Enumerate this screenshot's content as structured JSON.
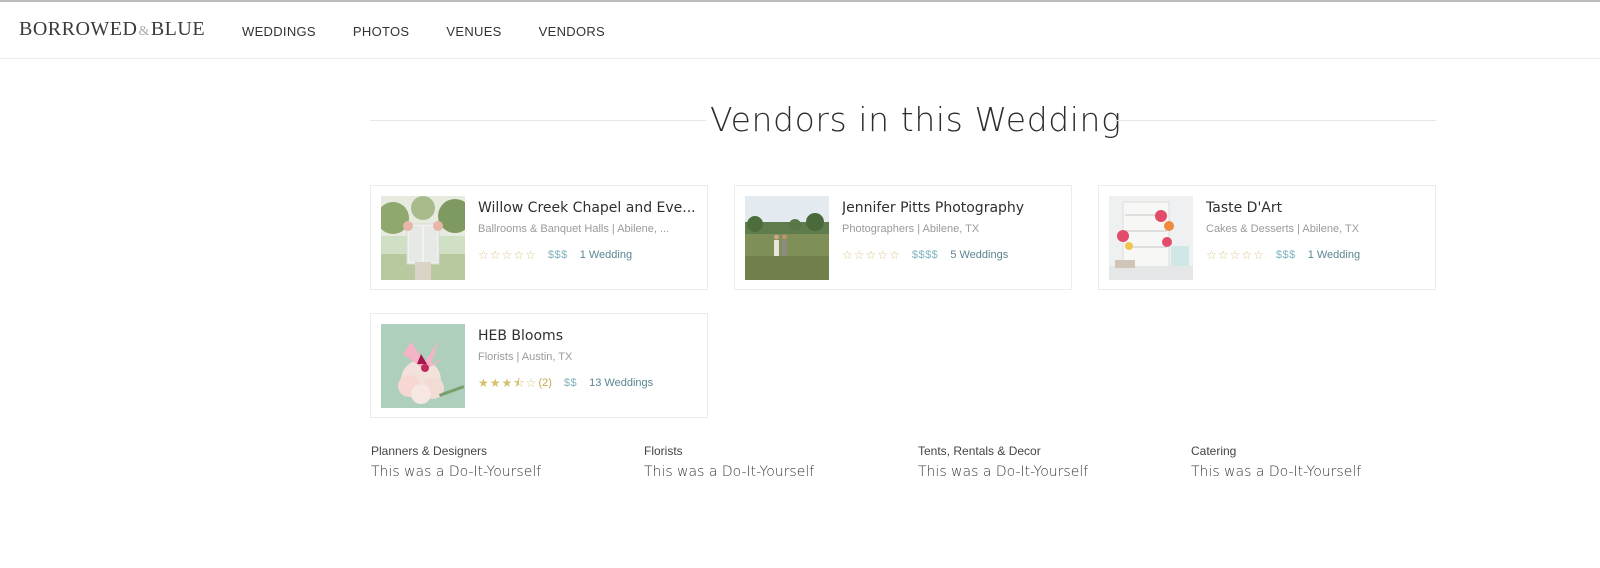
{
  "brand": {
    "logo_left": "BORROWED",
    "logo_amp": "&",
    "logo_right": "BLUE"
  },
  "nav": {
    "items": [
      {
        "label": "WEDDINGS"
      },
      {
        "label": "PHOTOS"
      },
      {
        "label": "VENUES"
      },
      {
        "label": "VENDORS"
      }
    ]
  },
  "section": {
    "title": "Vendors in this Wedding"
  },
  "colors": {
    "star": "#d6bf6a",
    "price": "#7fb3bd",
    "weddings_link": "#5b8593",
    "divider": "#e6e6e6"
  },
  "vendors": [
    {
      "name": "Willow Creek Chapel and Eve...",
      "meta": "Ballrooms & Banquet Halls | Abilene, ...",
      "rating": 0,
      "rating_count": "",
      "price": "$$$",
      "weddings": "1 Wedding",
      "image_icon": "chapel-photo"
    },
    {
      "name": "Jennifer Pitts Photography",
      "meta": "Photographers | Abilene, TX",
      "rating": 0,
      "rating_count": "",
      "price": "$$$$",
      "weddings": "5 Weddings",
      "image_icon": "couple-field-photo"
    },
    {
      "name": "Taste D'Art",
      "meta": "Cakes & Desserts | Abilene, TX",
      "rating": 0,
      "rating_count": "",
      "price": "$$$",
      "weddings": "1 Wedding",
      "image_icon": "dessert-table-photo"
    },
    {
      "name": "HEB Blooms",
      "meta": "Florists | Austin, TX",
      "rating": 3.5,
      "rating_count": "(2)",
      "price": "$$",
      "weddings": "13 Weddings",
      "image_icon": "bouquet-photo"
    }
  ],
  "diy": [
    {
      "category": "Planners & Designers",
      "text": "This was a Do-It-Yourself"
    },
    {
      "category": "Florists",
      "text": "This was a Do-It-Yourself"
    },
    {
      "category": "Tents, Rentals & Decor",
      "text": "This was a Do-It-Yourself"
    },
    {
      "category": "Catering",
      "text": "This was a Do-It-Yourself"
    }
  ]
}
